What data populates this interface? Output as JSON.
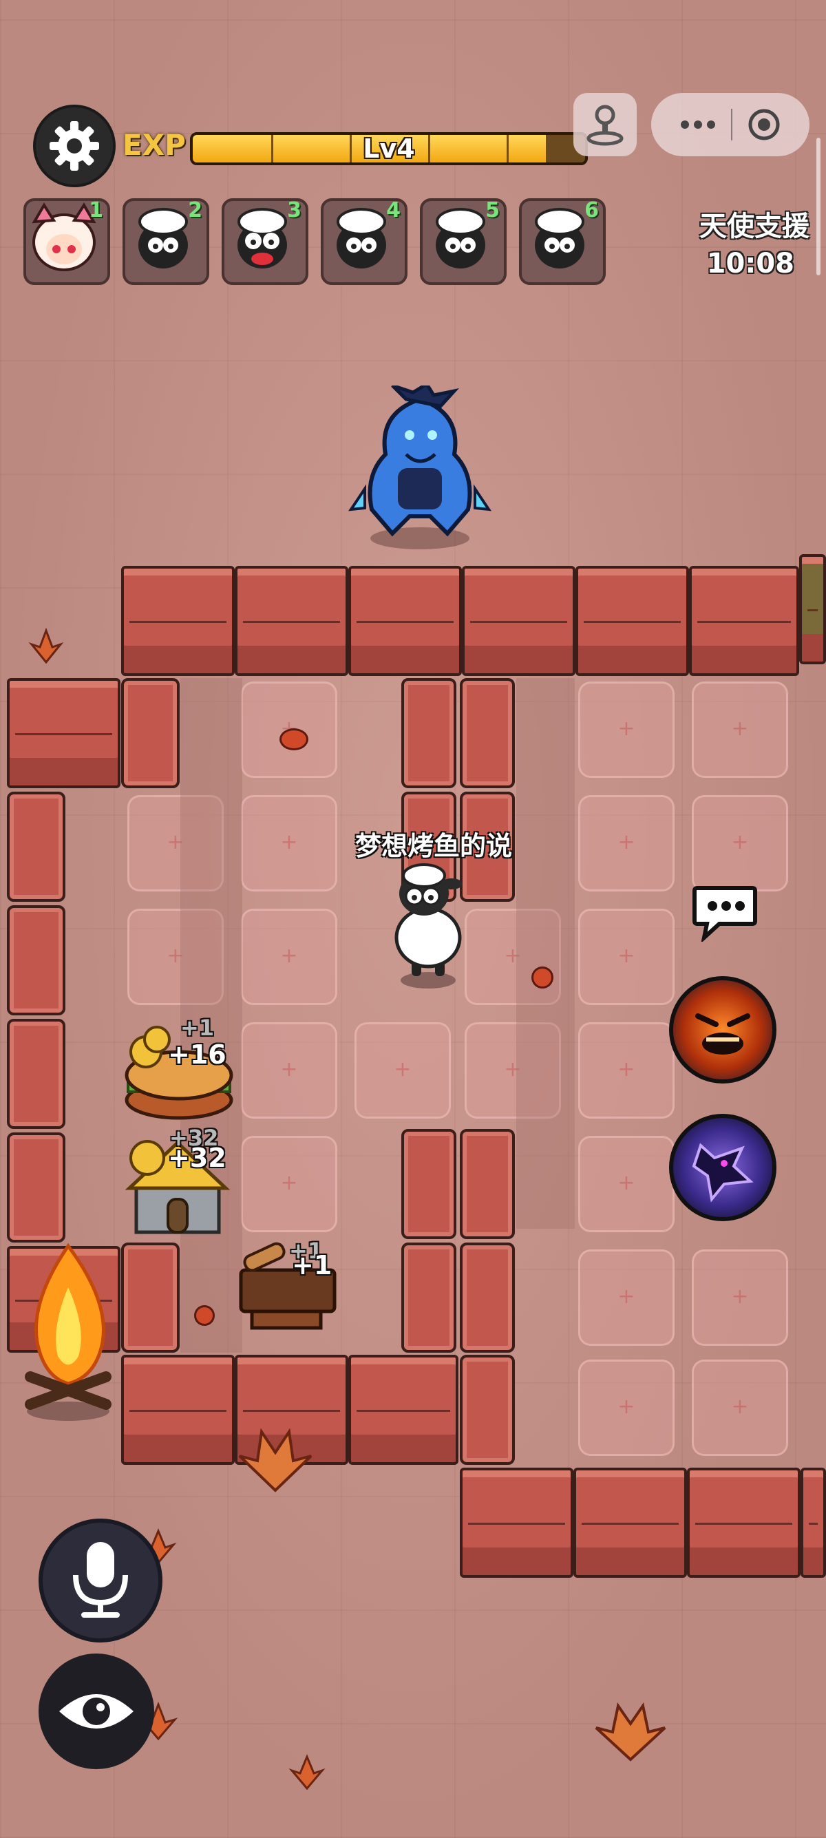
{
  "hud": {
    "exp_label": "EXP",
    "level_text": "Lv4",
    "exp_progress": 0.9,
    "settings_icon": "gear-icon"
  },
  "mini_program": {
    "joystick_icon": "joystick-icon",
    "more_icon": "more-dots-icon",
    "close_icon": "target-icon"
  },
  "party_slots": [
    {
      "num": "1",
      "char": "girl-hero"
    },
    {
      "num": "2",
      "char": "sheep"
    },
    {
      "num": "3",
      "char": "sheep-red-mouth"
    },
    {
      "num": "4",
      "char": "sheep"
    },
    {
      "num": "5",
      "char": "sheep"
    },
    {
      "num": "6",
      "char": "sheep"
    }
  ],
  "event": {
    "title": "天使支援",
    "time": "10:08"
  },
  "player": {
    "name": "梦想烤鱼的说"
  },
  "rewards": {
    "burger_top": "+1",
    "burger_main": "+16",
    "house_top": "+32",
    "house_main": "+32",
    "bench_top": "+1",
    "bench_main": "+1"
  },
  "controls": {
    "mic_icon": "microphone-icon",
    "eye_icon": "eye-icon",
    "chat_icon": "chat-bubble-icon",
    "skill_rage_icon": "rage-face-icon",
    "skill_wolf_icon": "wolf-howl-icon"
  },
  "colors": {
    "accent_gold": "#f2a812",
    "slot_number": "#7be37b",
    "wall_brick": "#c2574d"
  }
}
